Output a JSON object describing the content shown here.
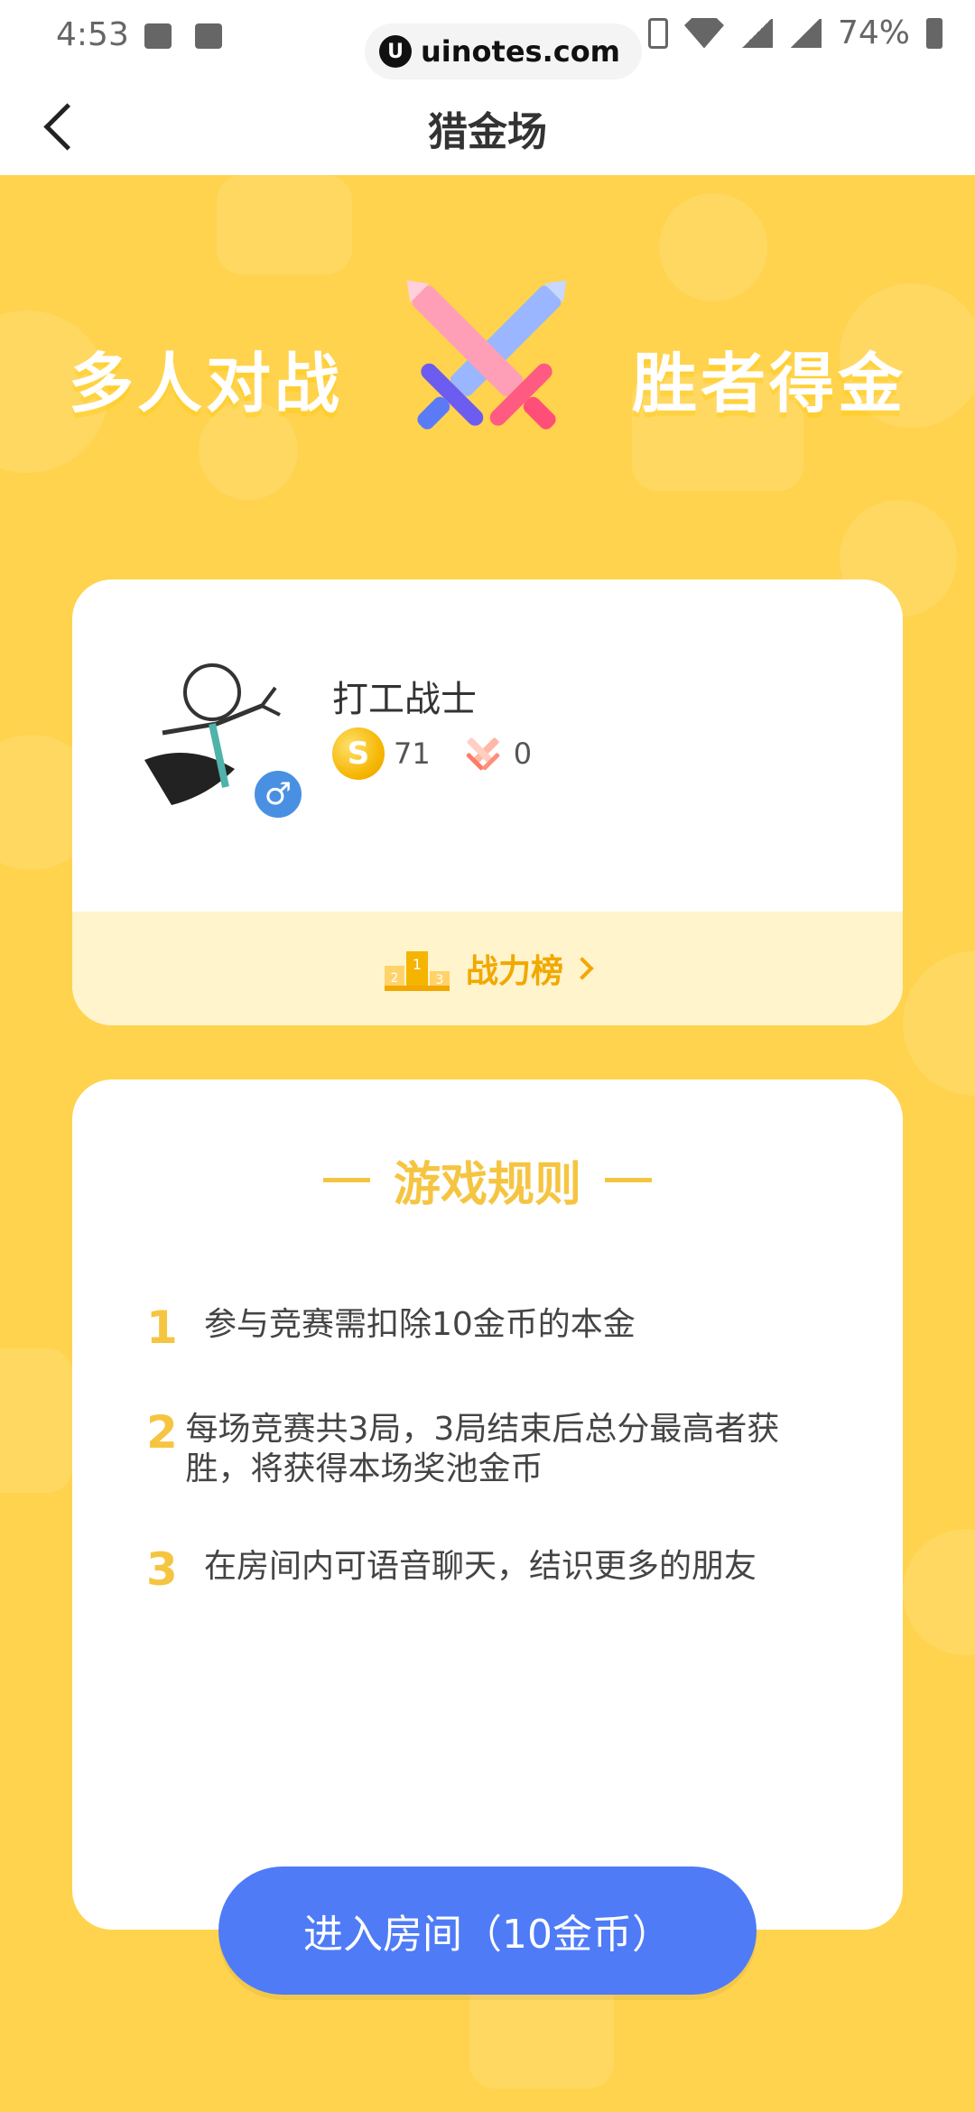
{
  "status_bar": {
    "time": "4:53",
    "battery": "74%"
  },
  "watermark": {
    "text": "uinotes.com"
  },
  "header": {
    "title": "猎金场"
  },
  "banner": {
    "left_text": "多人对战",
    "right_text": "胜者得金"
  },
  "profile": {
    "username": "打工战士",
    "coins": "71",
    "wins": "0",
    "gender_symbol": "♂",
    "leaderboard_label": "战力榜",
    "podium_numbers": [
      "2",
      "1",
      "3"
    ]
  },
  "rules": {
    "title": "游戏规则",
    "items": [
      {
        "num": "1",
        "text": "参与竞赛需扣除10金币的本金"
      },
      {
        "num": "2",
        "text": "每场竞赛共3局，3局结束后总分最高者获胜，将获得本场奖池金币"
      },
      {
        "num": "3",
        "text": "在房间内可语音聊天，结识更多的朋友"
      }
    ]
  },
  "cta": {
    "label": "进入房间（10金币）"
  },
  "colors": {
    "background": "#ffd34d",
    "accent_blue": "#4f7bf7",
    "rule_yellow": "#f5c542",
    "rank_gold": "#f1a800"
  },
  "icons": [
    "back-icon",
    "coin-icon",
    "sword-icon",
    "podium-icon",
    "chevron-right-icon",
    "crossed-swords-icon"
  ]
}
